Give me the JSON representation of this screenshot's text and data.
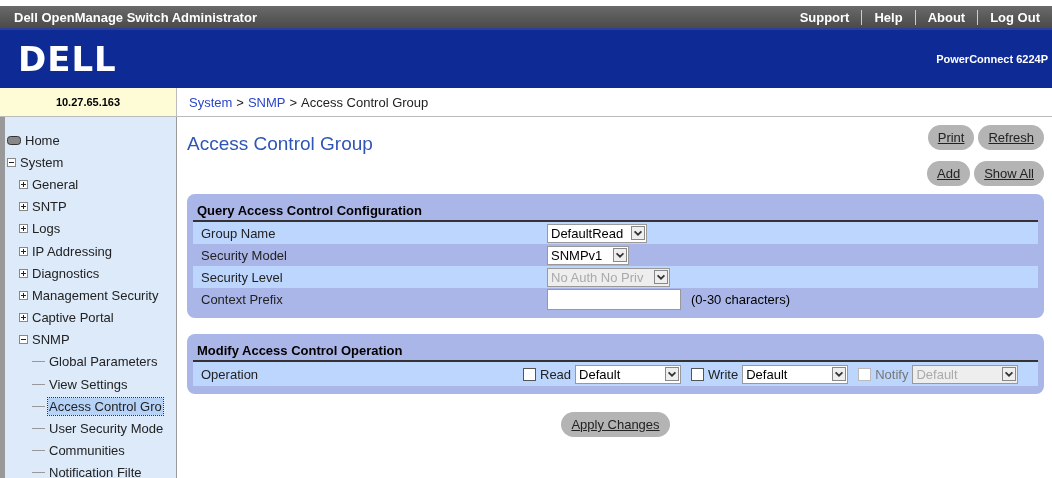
{
  "header": {
    "title": "Dell OpenManage Switch Administrator",
    "links": [
      "Support",
      "Help",
      "About",
      "Log Out"
    ]
  },
  "banner": {
    "logo": "DELL",
    "model": "PowerConnect 6224P"
  },
  "ip_address": "10.27.65.163",
  "breadcrumb": {
    "separator": ">",
    "items": [
      {
        "label": "System",
        "link": true
      },
      {
        "label": "SNMP",
        "link": true
      },
      {
        "label": "Access Control Group",
        "link": false
      }
    ]
  },
  "sidebar": {
    "items": [
      {
        "label": "Home",
        "kind": "root",
        "selected": false
      },
      {
        "label": "System",
        "kind": "folder",
        "expanded": true,
        "selected": false,
        "children": [
          {
            "label": "General",
            "kind": "folder",
            "expanded": false,
            "selected": false
          },
          {
            "label": "SNTP",
            "kind": "folder",
            "expanded": false,
            "selected": false
          },
          {
            "label": "Logs",
            "kind": "folder",
            "expanded": false,
            "selected": false
          },
          {
            "label": "IP Addressing",
            "kind": "folder",
            "expanded": false,
            "selected": false
          },
          {
            "label": "Diagnostics",
            "kind": "folder",
            "expanded": false,
            "selected": false
          },
          {
            "label": "Management Security",
            "kind": "folder",
            "expanded": false,
            "selected": false
          },
          {
            "label": "Captive Portal",
            "kind": "folder",
            "expanded": false,
            "selected": false
          },
          {
            "label": "SNMP",
            "kind": "folder",
            "expanded": true,
            "selected": false,
            "children": [
              {
                "label": "Global Parameters",
                "kind": "leaf",
                "selected": false
              },
              {
                "label": "View Settings",
                "kind": "leaf",
                "selected": false
              },
              {
                "label": "Access Control Gro",
                "kind": "leaf",
                "selected": true
              },
              {
                "label": "User Security Mode",
                "kind": "leaf",
                "selected": false
              },
              {
                "label": "Communities",
                "kind": "leaf",
                "selected": false
              },
              {
                "label": "Notification Filte",
                "kind": "leaf",
                "selected": false
              }
            ]
          }
        ]
      }
    ]
  },
  "page": {
    "title": "Access Control Group",
    "buttons_top": [
      "Print",
      "Refresh"
    ],
    "buttons_second": [
      "Add",
      "Show All"
    ]
  },
  "query_panel": {
    "title": "Query Access Control Configuration",
    "rows": [
      {
        "label": "Group Name",
        "kind": "select",
        "value": "DefaultRead",
        "disabled": false
      },
      {
        "label": "Security Model",
        "kind": "select",
        "value": "SNMPv1",
        "disabled": false
      },
      {
        "label": "Security Level",
        "kind": "select",
        "value": "No Auth No Priv",
        "disabled": true
      },
      {
        "label": "Context Prefix",
        "kind": "text",
        "value": "",
        "hint": "(0-30 characters)",
        "disabled": false
      }
    ]
  },
  "modify_panel": {
    "title": "Modify Access Control Operation",
    "label": "Operation",
    "options": [
      {
        "label": "Read",
        "checked": false,
        "value": "Default",
        "disabled": false
      },
      {
        "label": "Write",
        "checked": false,
        "value": "Default",
        "disabled": false
      },
      {
        "label": "Notify",
        "checked": false,
        "value": "Default",
        "disabled": true
      }
    ]
  },
  "apply_button": "Apply Changes"
}
